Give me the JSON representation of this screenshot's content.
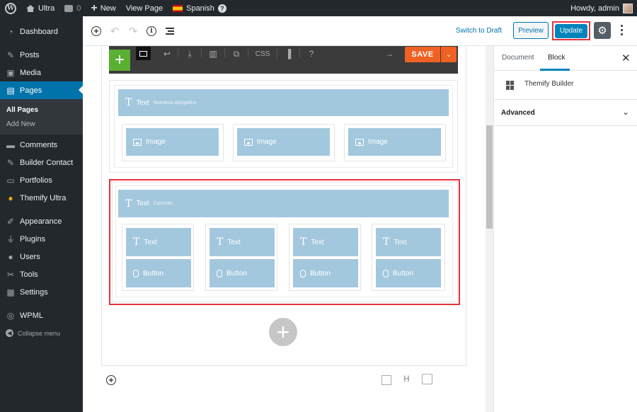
{
  "adminbar": {
    "site_name": "Ultra",
    "comments_count": "0",
    "new_label": "New",
    "view_page_label": "View Page",
    "language_label": "Spanish",
    "greeting": "Howdy, admin"
  },
  "sidebar": {
    "items": [
      {
        "label": "Dashboard",
        "icon": "dashboard-icon"
      },
      {
        "label": "Posts",
        "icon": "pin-icon"
      },
      {
        "label": "Media",
        "icon": "media-icon"
      },
      {
        "label": "Pages",
        "icon": "pages-icon"
      },
      {
        "label": "Comments",
        "icon": "comments-icon"
      },
      {
        "label": "Builder Contact",
        "icon": "pin-icon"
      },
      {
        "label": "Portfolios",
        "icon": "folder-icon"
      },
      {
        "label": "Themify Ultra",
        "icon": "themify-icon"
      },
      {
        "label": "Appearance",
        "icon": "brush-icon"
      },
      {
        "label": "Plugins",
        "icon": "plugin-icon"
      },
      {
        "label": "Users",
        "icon": "users-icon"
      },
      {
        "label": "Tools",
        "icon": "wrench-icon"
      },
      {
        "label": "Settings",
        "icon": "settings-icon"
      },
      {
        "label": "WPML",
        "icon": "wpml-icon"
      }
    ],
    "submenu": [
      "All Pages",
      "Add New"
    ],
    "collapse_label": "Collapse menu"
  },
  "editor_toolbar": {
    "switch_draft": "Switch to Draft",
    "preview": "Preview",
    "update": "Update"
  },
  "themify_toolbar": {
    "css_label": "CSS",
    "help_label": "?",
    "save_label": "SAVE"
  },
  "rows": {
    "row1_heading": {
      "label": "Text",
      "sub": "Nuestros abogados"
    },
    "row1_images": [
      "Image",
      "Image",
      "Image"
    ],
    "row2_heading": {
      "label": "Text",
      "sub": "Carreras"
    },
    "row2_text_modules": [
      "Text",
      "Text",
      "Text",
      "Text"
    ],
    "row2_button_modules": [
      "Button",
      "Button",
      "Button",
      "Button"
    ]
  },
  "bottom_bar": {
    "heading_label": "H"
  },
  "settings_panel": {
    "tab_document": "Document",
    "tab_block": "Block",
    "block_name": "Themify Builder",
    "advanced_label": "Advanced"
  },
  "colors": {
    "admin_dark": "#23282d",
    "accent_blue": "#0073aa",
    "save_orange": "#f06124",
    "module_blue": "#a3c8de",
    "highlight_red": "#e5343e",
    "add_green": "#59b033"
  }
}
